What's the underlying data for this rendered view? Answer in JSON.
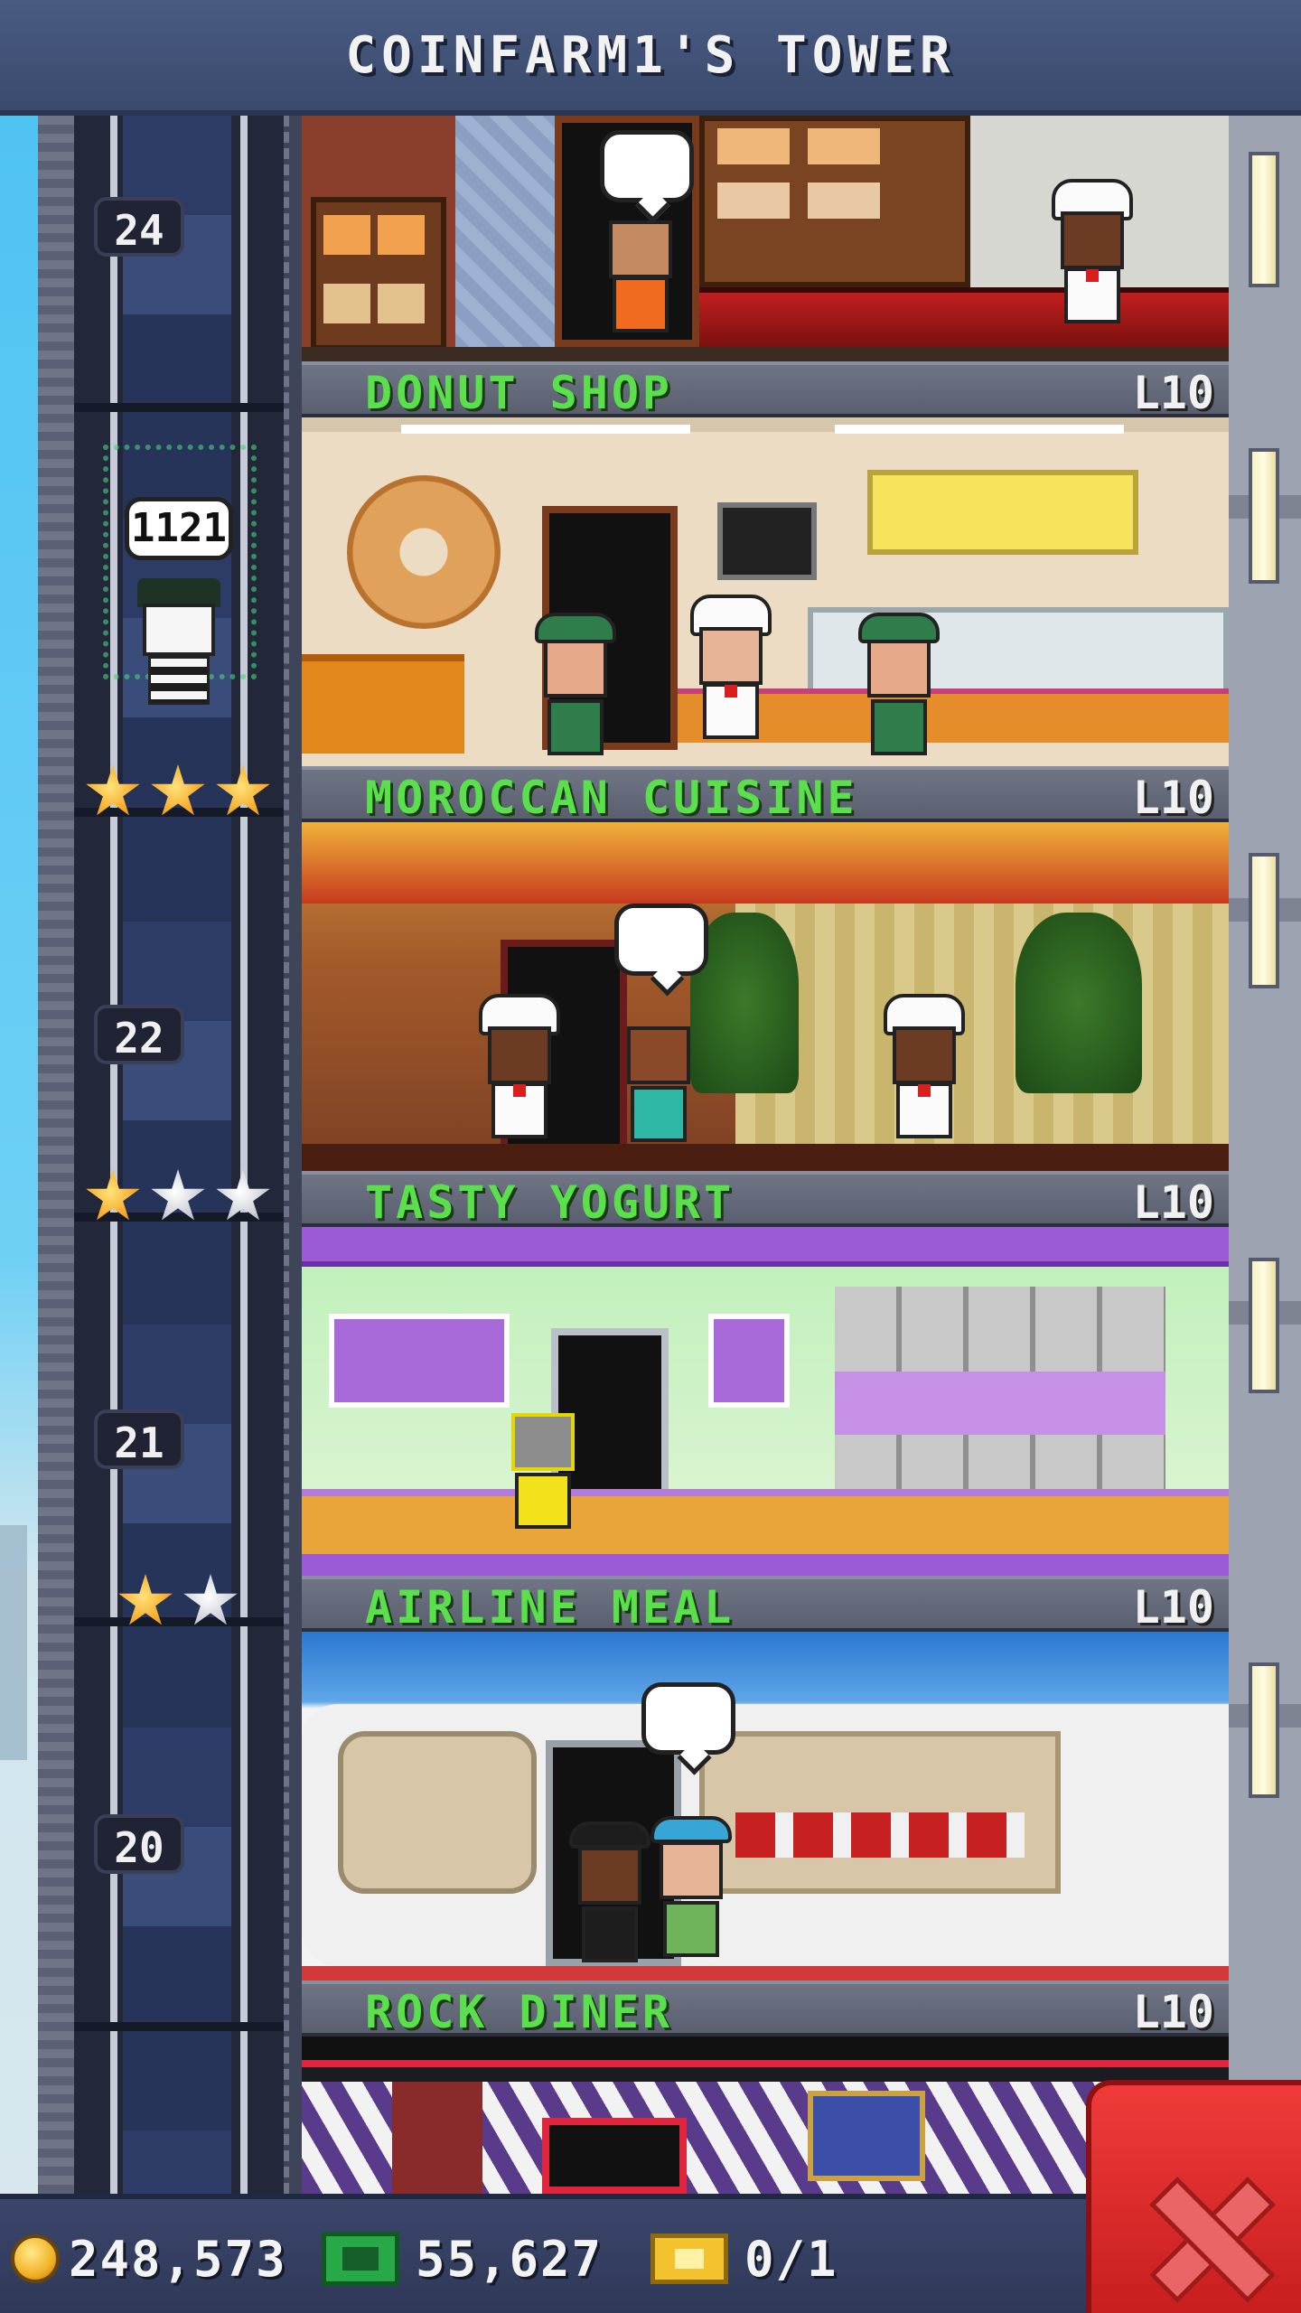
{
  "header": {
    "title": "COINFARM1'S TOWER"
  },
  "elevator": {
    "passenger_count": "1121"
  },
  "shaft_floors": [
    {
      "number": "24"
    },
    {
      "number": "22"
    },
    {
      "number": "21"
    },
    {
      "number": "20"
    }
  ],
  "floors": [
    {
      "name": "DONUT SHOP",
      "level": "L10",
      "stars_gold": 3,
      "stars_total": 3
    },
    {
      "name": "MOROCCAN CUISINE",
      "level": "L10",
      "stars_gold": 1,
      "stars_total": 3
    },
    {
      "name": "TASTY YOGURT",
      "level": "L10",
      "stars_gold": 1,
      "stars_total": 2
    },
    {
      "name": "AIRLINE MEAL",
      "level": "L10"
    },
    {
      "name": "ROCK DINER",
      "level": "L10"
    }
  ],
  "footer": {
    "coins": "248,573",
    "bux": "55,627",
    "tickets": "0/1"
  },
  "colors": {
    "floor_name_green": "#59e04a",
    "header_bg": "#3f4f76",
    "close_red": "#d92626"
  },
  "icons": {
    "coins": "coin-icon",
    "bux": "bux-icon",
    "tickets": "ticket-icon",
    "close": "close-icon",
    "star": "star-icon"
  }
}
